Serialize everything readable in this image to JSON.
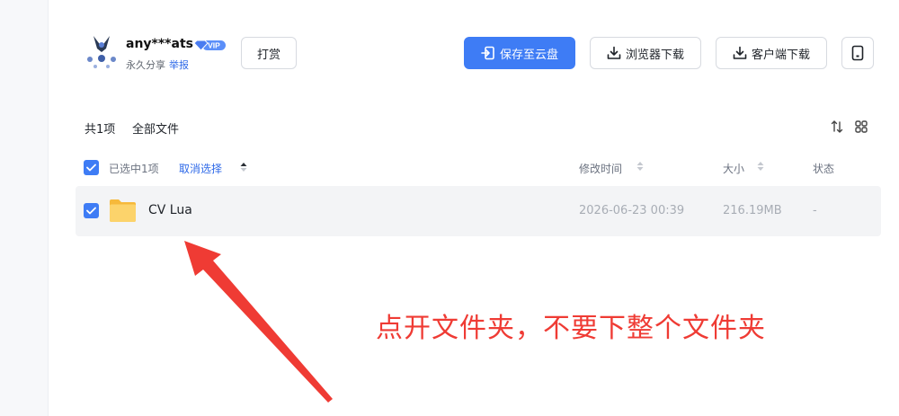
{
  "user": {
    "name": "any***ats",
    "vip_label": "VIP",
    "share_type": "永久分享",
    "report_label": "举报"
  },
  "toolbar": {
    "tip_label": "打赏",
    "save_label": "保存至云盘",
    "browser_download_label": "浏览器下载",
    "client_download_label": "客户端下载"
  },
  "summary": {
    "count_label": "共1项",
    "breadcrumb": "全部文件"
  },
  "table": {
    "selected_label": "已选中1项",
    "cancel_label": "取消选择",
    "columns": {
      "modified": "修改时间",
      "size": "大小",
      "status": "状态"
    },
    "rows": [
      {
        "name": "CV Lua",
        "modified": "2026-06-23 00:39",
        "size": "216.19MB",
        "status": "-"
      }
    ]
  },
  "annotation": {
    "text": "点开文件夹，不要下整个文件夹"
  },
  "colors": {
    "accent": "#3e7cf5",
    "link": "#2f6ae8",
    "annotation": "#ef3b34",
    "folder": "#fcd36b"
  },
  "icons": [
    "avatar",
    "vip-diamond-icon",
    "save-to-cloud-icon",
    "download-icon",
    "more-device-icon",
    "sort-icon",
    "grid-view-icon",
    "check-icon",
    "folder-icon"
  ]
}
